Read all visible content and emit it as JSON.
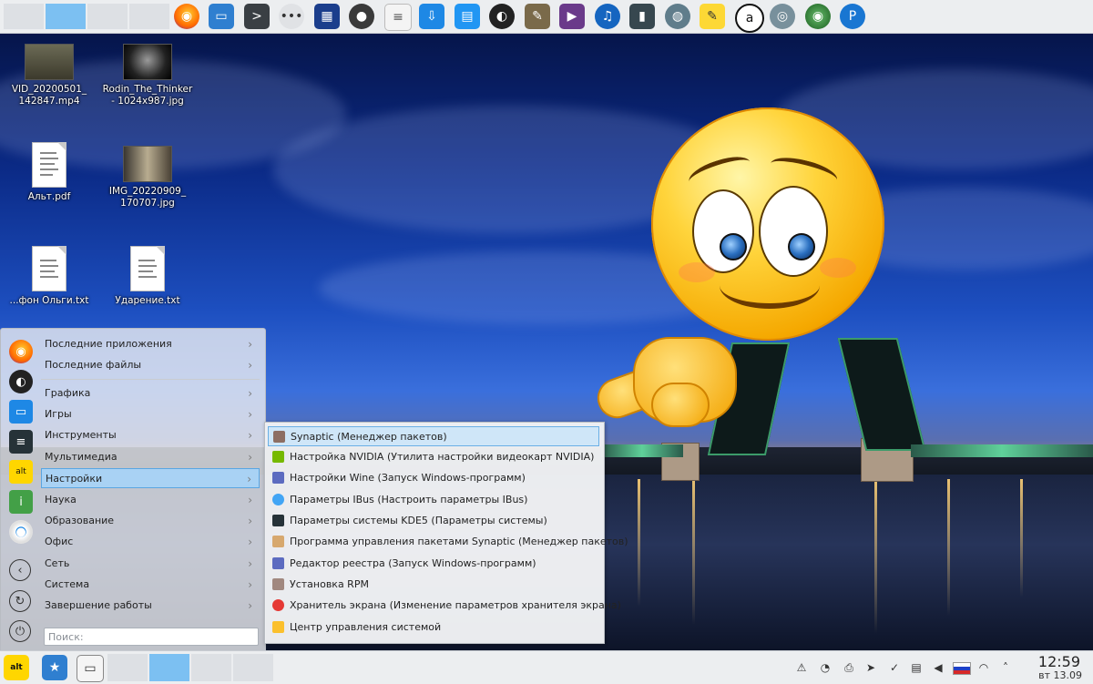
{
  "desktop": {
    "icons": [
      {
        "label": "VID_20200501_ 142847.mp4"
      },
      {
        "label": "Rodin_The_Thinker- 1024x987.jpg"
      },
      {
        "label": "Альт.pdf"
      },
      {
        "label": "IMG_20220909_ 170707.jpg"
      },
      {
        "label": "...фон Ольги.txt"
      },
      {
        "label": "Ударение.txt"
      }
    ]
  },
  "start_menu": {
    "items": [
      {
        "label": "Последние приложения"
      },
      {
        "label": "Последние файлы"
      },
      {
        "label": "Графика"
      },
      {
        "label": "Игры"
      },
      {
        "label": "Инструменты"
      },
      {
        "label": "Мультимедиа"
      },
      {
        "label": "Настройки"
      },
      {
        "label": "Наука"
      },
      {
        "label": "Образование"
      },
      {
        "label": "Офис"
      },
      {
        "label": "Сеть"
      },
      {
        "label": "Система"
      },
      {
        "label": "Завершение работы"
      }
    ],
    "search_placeholder": "Поиск:"
  },
  "submenu": {
    "items": [
      {
        "label": "Synaptic (Менеджер пакетов)",
        "icon": "synaptic-icon"
      },
      {
        "label": "Настройка NVIDIA (Утилита настройки видеокарт NVIDIA)",
        "icon": "nvidia-icon"
      },
      {
        "label": "Настройки Wine (Запуск Windows-программ)",
        "icon": "wine-icon"
      },
      {
        "label": "Параметры IBus (Настроить параметры IBus)",
        "icon": "ibus-icon"
      },
      {
        "label": "Параметры системы KDE5 (Параметры системы)",
        "icon": "kde-settings-icon"
      },
      {
        "label": "Программа управления пакетами Synaptic (Менеджер пакетов)",
        "icon": "package-manager-icon"
      },
      {
        "label": "Редактор реестра (Запуск Windows-программ)",
        "icon": "registry-editor-icon"
      },
      {
        "label": "Установка RPM",
        "icon": "rpm-install-icon"
      },
      {
        "label": "Хранитель экрана (Изменение параметров хранителя экрана)",
        "icon": "screensaver-icon"
      },
      {
        "label": "Центр управления системой",
        "icon": "control-center-icon"
      }
    ]
  },
  "clock": {
    "time": "12:59",
    "date": "вт 13.09"
  },
  "colors": {
    "accent": "#7cc0f2",
    "selection": "#a9d2f4",
    "panel": "#eceef0"
  }
}
